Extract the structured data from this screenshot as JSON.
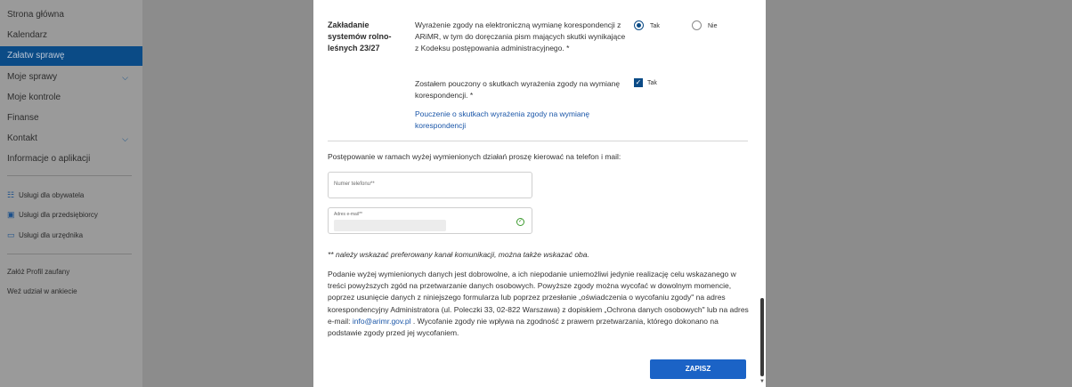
{
  "sidebar": {
    "items": [
      {
        "label": "Strona główna"
      },
      {
        "label": "Kalendarz"
      },
      {
        "label": "Załatw sprawę"
      },
      {
        "label": "Moje sprawy"
      },
      {
        "label": "Moje kontrole"
      },
      {
        "label": "Finanse"
      },
      {
        "label": "Kontakt"
      },
      {
        "label": "Informacje o aplikacji"
      }
    ],
    "services": [
      {
        "label": "Usługi dla obywatela",
        "icon": "person-icon"
      },
      {
        "label": "Usługi dla przedsiębiorcy",
        "icon": "briefcase-icon"
      },
      {
        "label": "Usługi dla urzędnika",
        "icon": "monitor-icon"
      }
    ],
    "extra": [
      {
        "label": "Załóż Profil zaufany"
      },
      {
        "label": "Weź udział w ankiecie"
      }
    ]
  },
  "consent": {
    "section_title": "Zakładanie systemów rolno-leśnych 23/27",
    "question1": "Wyrażenie zgody na elektroniczną wymianę korespondencji z ARiMR, w tym do doręczania pism mających skutki wynikające z Kodeksu postępowania administracyjnego. *",
    "option_yes": "Tak",
    "option_no": "Nie",
    "question2": "Zostałem pouczony o skutkach wyrażenia zgody na wymianę korespondencji. *",
    "checkbox_label": "Tak",
    "link": "Pouczenie o skutkach wyrażenia zgody na wymianę korespondencji"
  },
  "contact": {
    "intro": "Postępowanie w ramach wyżej wymienionych działań proszę kierować na telefon i mail:",
    "phone_placeholder": "Numer telefonu**",
    "email_label": "Adres e-mail**",
    "note": "** należy wskazać preferowany kanał komunikacji, można także wskazać oba.",
    "paragraph_part1": "Podanie wyżej wymienionych danych jest dobrowolne, a ich niepodanie uniemożliwi jedynie realizację celu wskazanego w treści powyższych zgód na przetwarzanie danych osobowych. Powyższe zgody można wycofać w dowolnym momencie, poprzez usunięcie danych z niniejszego formularza lub poprzez przesłanie „oświadczenia o wycofaniu zgody\" na adres korespondencyjny Administratora (ul. Poleczki 33, 02-822 Warszawa) z dopiskiem „Ochrona danych osobowych\" lub na adres e-mail: ",
    "paragraph_email": "info@arimr.gov.pl",
    "paragraph_part2": " . Wycofanie zgody nie wpływa na zgodność z prawem przetwarzania, którego dokonano na podstawie zgody przed jej wycofaniem."
  },
  "actions": {
    "save_label": "ZAPISZ"
  }
}
